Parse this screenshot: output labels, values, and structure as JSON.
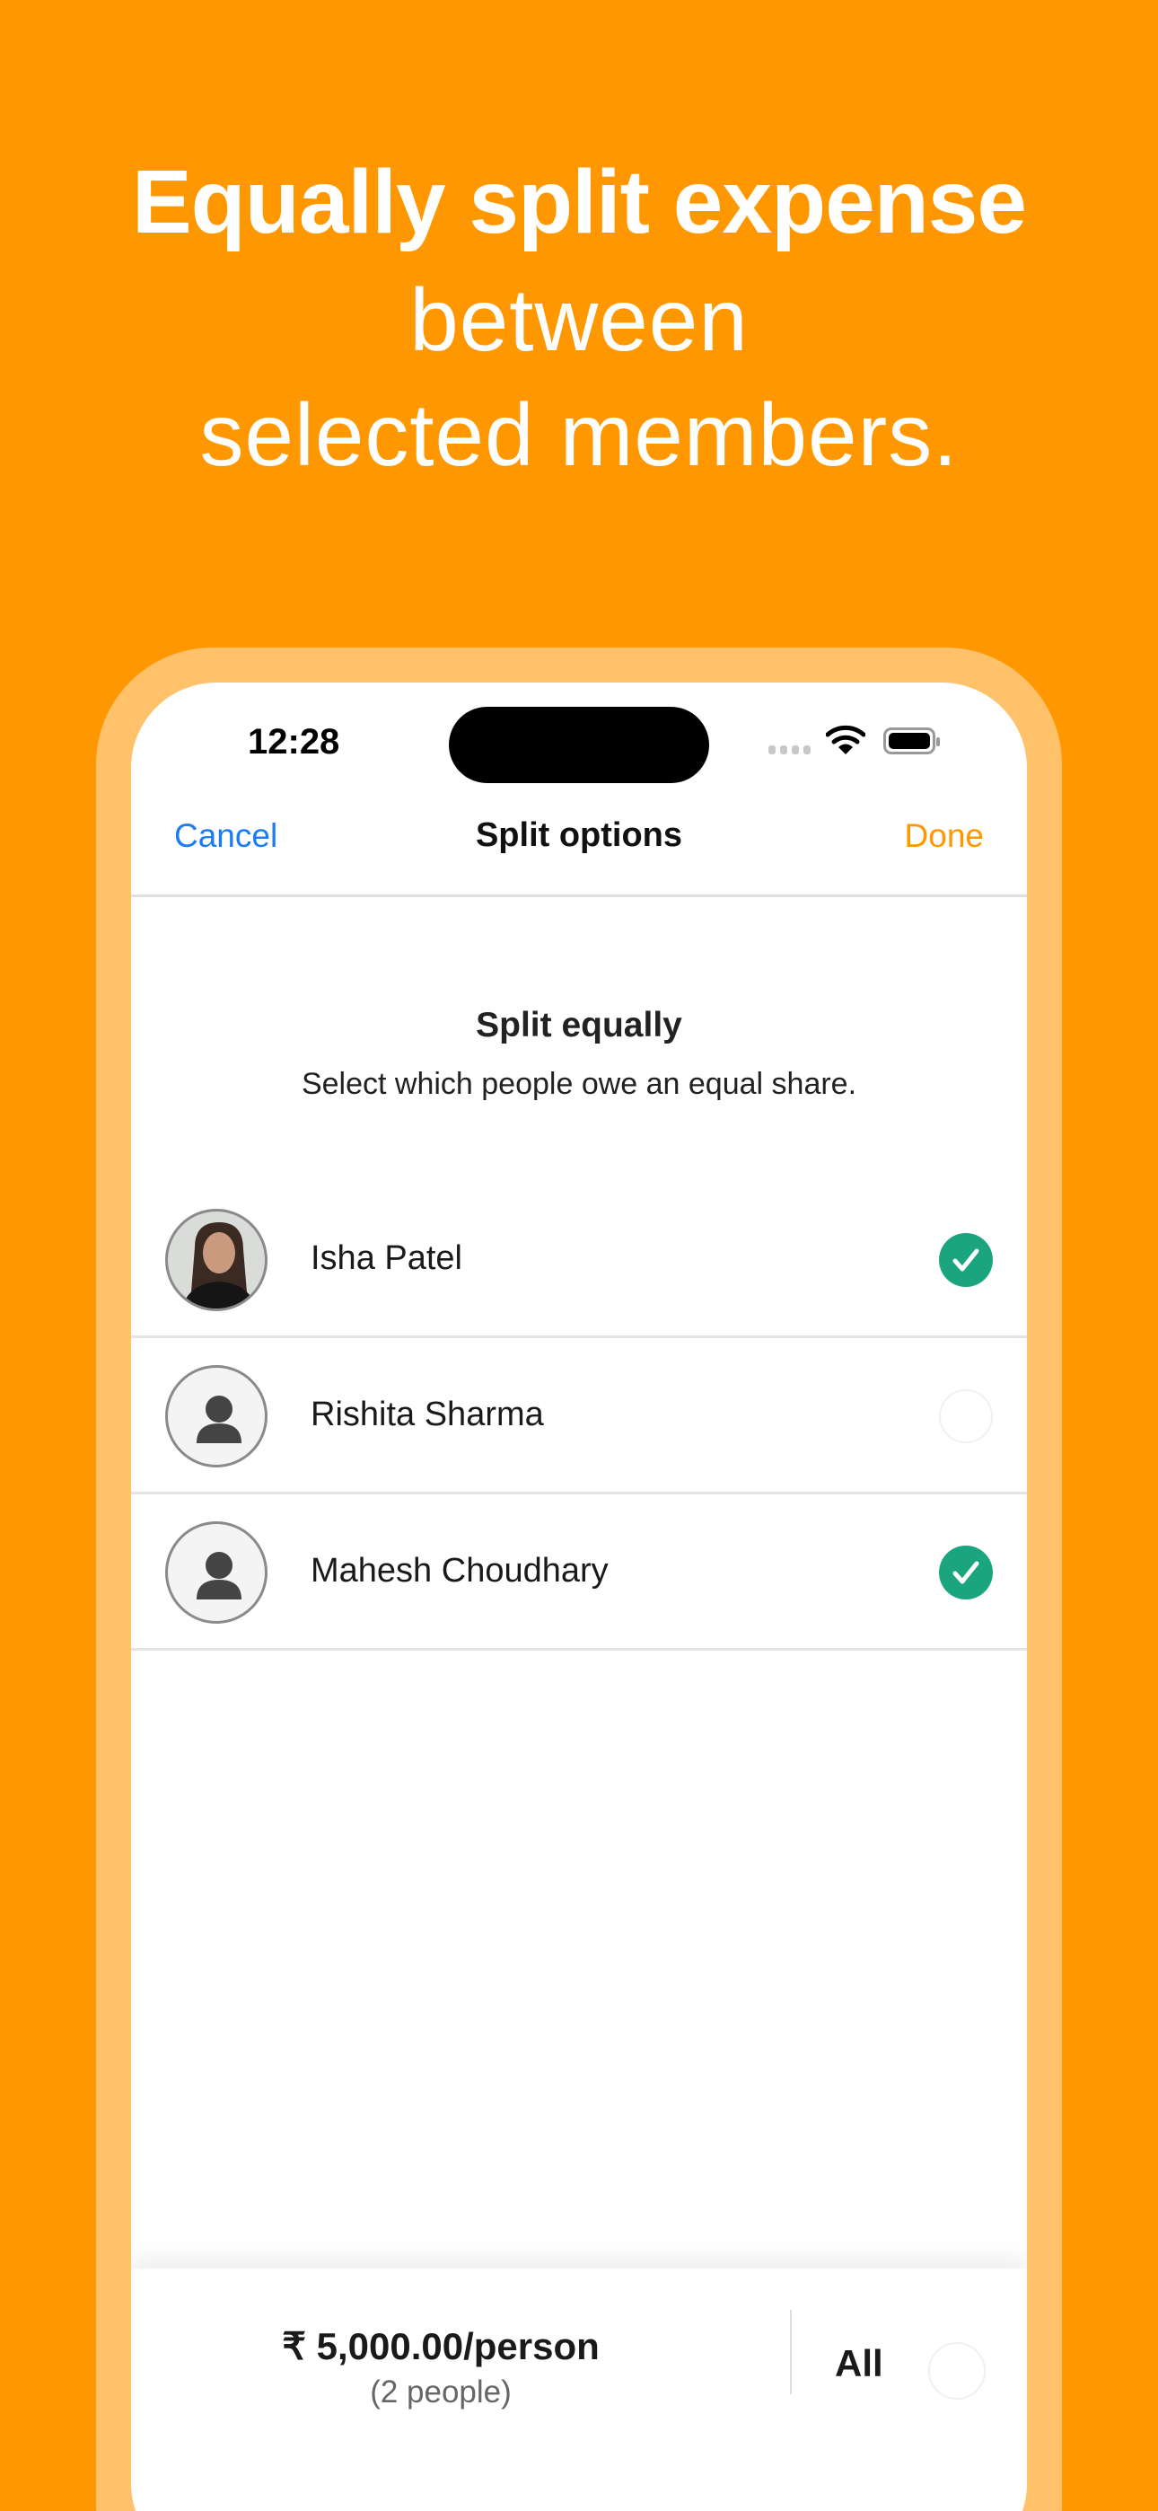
{
  "headline": {
    "line1": "Equally split expense",
    "line2": "between",
    "line3": "selected members."
  },
  "status_bar": {
    "time": "12:28"
  },
  "nav": {
    "cancel": "Cancel",
    "title": "Split options",
    "done": "Done"
  },
  "section": {
    "title": "Split equally",
    "subtitle": "Select which people owe an equal share."
  },
  "members": [
    {
      "name": "Isha Patel",
      "selected": true,
      "avatar": "photo"
    },
    {
      "name": "Rishita Sharma",
      "selected": false,
      "avatar": "person-icon"
    },
    {
      "name": "Mahesh Choudhary",
      "selected": true,
      "avatar": "person-icon"
    }
  ],
  "summary": {
    "amount": "₹ 5,000.00/person",
    "people": "(2 people)",
    "all_label": "All",
    "all_selected": false
  },
  "colors": {
    "background": "#FF9800",
    "frame": "#FFC169",
    "link": "#1E7CF2",
    "done": "#FF9800",
    "check": "#1BA57F"
  }
}
